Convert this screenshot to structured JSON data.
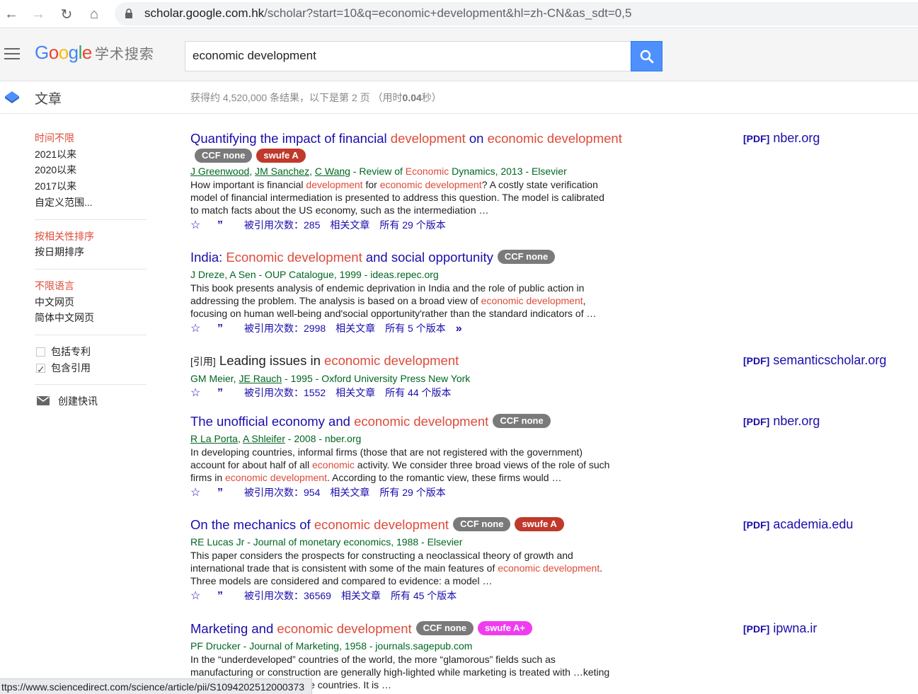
{
  "browser": {
    "url_host": "scholar.google.com.hk",
    "url_path": "/scholar?start=10&q=economic+development&hl=zh-CN&as_sdt=0,5"
  },
  "header": {
    "logo": "Google",
    "logo_sub": "学术搜索",
    "search_value": "economic development"
  },
  "subbar": {
    "section_label": "文章",
    "result_count_prefix": "获得约 4,520,000 条结果，以下是第 2 页 （用时",
    "result_time": "0.04",
    "result_count_suffix": "秒）"
  },
  "sidebar": {
    "time": [
      "时间不限",
      "2021以来",
      "2020以来",
      "2017以来",
      "自定义范围..."
    ],
    "sort": [
      "按相关性排序",
      "按日期排序"
    ],
    "lang": [
      "不限语言",
      "中文网页",
      "简体中文网页"
    ],
    "include_patents": "包括专利",
    "include_citations": "包含引用",
    "create_alert": "创建快讯"
  },
  "results": [
    {
      "title_a": "Quantifying the impact of financial ",
      "title_b": "development",
      "title_c": " on ",
      "title_d": "economic development",
      "badge1": "CCF none",
      "badge2": "swufe A",
      "authors_1": "J Greenwood",
      "authors_2": "JM Sanchez",
      "authors_3": "C Wang",
      "meta_a": " - Review of ",
      "meta_hl": "Economic",
      "meta_b": " Dynamics, 2013 - Elsevier",
      "snip_1": "How important is financial ",
      "snip_hl1": "development",
      "snip_2": " for ",
      "snip_hl2": "economic development",
      "snip_3": "? A costly state verification model of financial intermediation is presented to address this question. The model is calibrated to match facts about the US economy, such as the intermediation …",
      "cited": "被引用次数：285",
      "related": "相关文章",
      "versions": "所有 29 个版本",
      "pdf_label": "[PDF]",
      "pdf_site": "nber.org"
    },
    {
      "title_a": "India: ",
      "title_b": "Economic development",
      "title_c": " and social opportunity",
      "badge1": "CCF none",
      "meta": "J Dreze, A Sen - OUP Catalogue, 1999 - ideas.repec.org",
      "snip_1": "This book presents analysis of endemic deprivation in India and the role of public action in addressing the problem. The analysis is based on a broad view of ",
      "snip_hl1": "economic development",
      "snip_2": ", focusing on human well-being and'social opportunity'rather than the standard indicators of …",
      "cited": "被引用次数：2998",
      "related": "相关文章",
      "versions": "所有 5 个版本"
    },
    {
      "tag": "[引用]",
      "title_a": " Leading issues in ",
      "title_b": "economic development",
      "meta_a": "GM Meier, ",
      "authors_2": "JE Rauch",
      "meta_b": " - 1995 - Oxford University Press New York",
      "cited": "被引用次数：1552",
      "related": "相关文章",
      "versions": "所有 44 个版本",
      "pdf_label": "[PDF]",
      "pdf_site": "semanticscholar.org"
    },
    {
      "title_a": "The unofficial economy and ",
      "title_b": "economic development",
      "badge1": "CCF none",
      "authors_1": "R La Porta",
      "authors_2": "A Shleifer",
      "meta_b": " - 2008 - nber.org",
      "snip_1": "In developing countries, informal firms (those that are not registered with the government) account for about half of all ",
      "snip_hl1": "economic",
      "snip_2": " activity. We consider three broad views of the role of such firms in ",
      "snip_hl2": "economic development",
      "snip_3": ". According to the romantic view, these firms would …",
      "cited": "被引用次数：954",
      "related": "相关文章",
      "versions": "所有 29 个版本",
      "pdf_label": "[PDF]",
      "pdf_site": "nber.org"
    },
    {
      "title_a": "On the mechanics of ",
      "title_b": "economic development",
      "badge1": "CCF none",
      "badge2": "swufe A",
      "meta": "RE Lucas Jr - Journal of monetary economics, 1988 - Elsevier",
      "snip_1": "This paper considers the prospects for constructing a neoclassical theory of growth and international trade that is consistent with some of the main features of ",
      "snip_hl1": "economic development",
      "snip_2": ". Three models are considered and compared to evidence: a model …",
      "cited": "被引用次数：36569",
      "related": "相关文章",
      "versions": "所有 45 个版本",
      "pdf_label": "[PDF]",
      "pdf_site": "academia.edu"
    },
    {
      "title_a": "Marketing and ",
      "title_b": "economic development",
      "badge1": "CCF none",
      "badge2": "swufe A+",
      "meta": "PF Drucker - Journal of Marketing, 1958 - journals.sagepub.com",
      "snip_1": "In the “underdeveloped” countries of the world, the more “glamorous” fields such as manufacturing or construction are generally high-lighted while marketing is treated with …keting holds a key position in these countries. It is …",
      "pdf_label": "[PDF]",
      "pdf_site": "ipwna.ir"
    }
  ],
  "statusbar": "ttps://www.sciencedirect.com/science/article/pii/S1094202512000373",
  "colors": {
    "accent": "#4d90fe",
    "link": "#1a0dab",
    "highlight": "#dd4b39",
    "meta": "#006621"
  }
}
